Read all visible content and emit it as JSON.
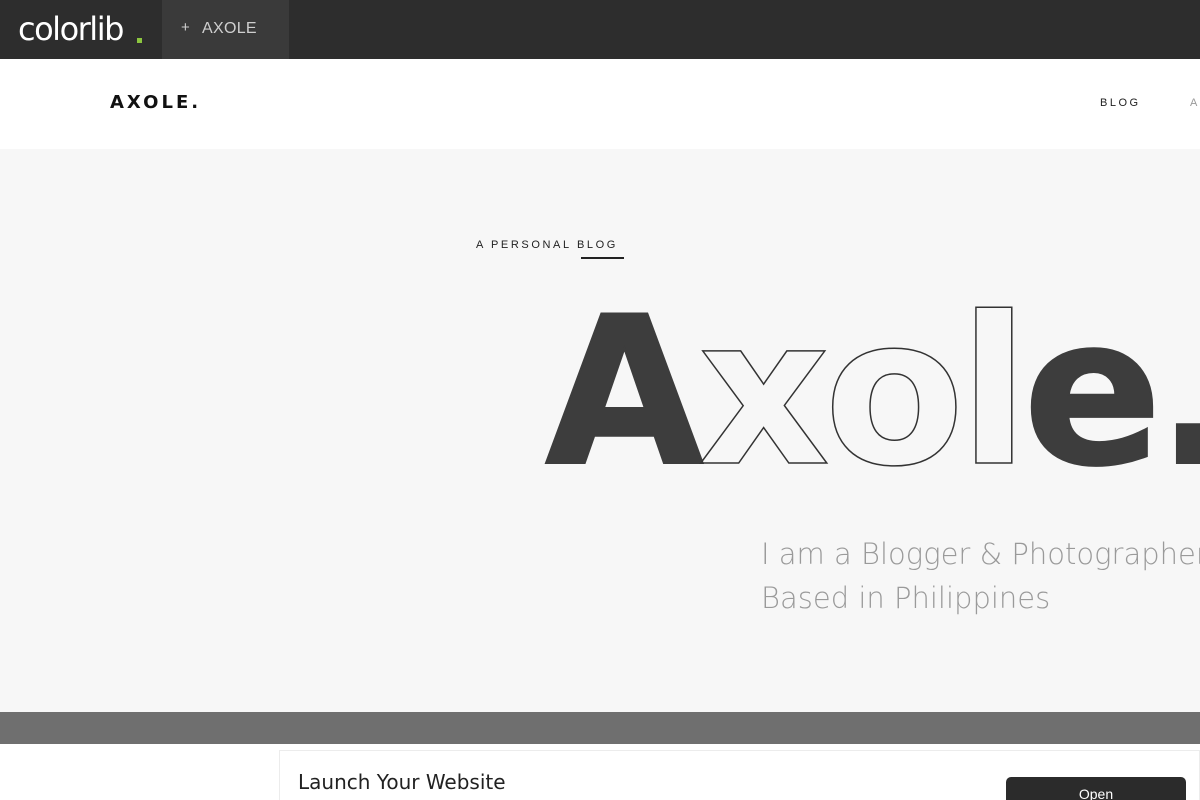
{
  "demo_bar": {
    "logo": "colorlib",
    "logo_dot_color": "#8cc63f",
    "tab_icon": "plus-icon",
    "tab_label": "AXOLE"
  },
  "header": {
    "brand": "AXOLE.",
    "nav": [
      "BLOG",
      "A"
    ]
  },
  "hero": {
    "eyebrow_prefix": "A PERSONAL",
    "eyebrow_highlight": "BLOG",
    "title": "Axole.",
    "tagline_line1": "I am a Blogger & Photographer",
    "tagline_line2": "Based in Philippines"
  },
  "ad": {
    "title": "Launch Your Website",
    "button": "Open"
  }
}
